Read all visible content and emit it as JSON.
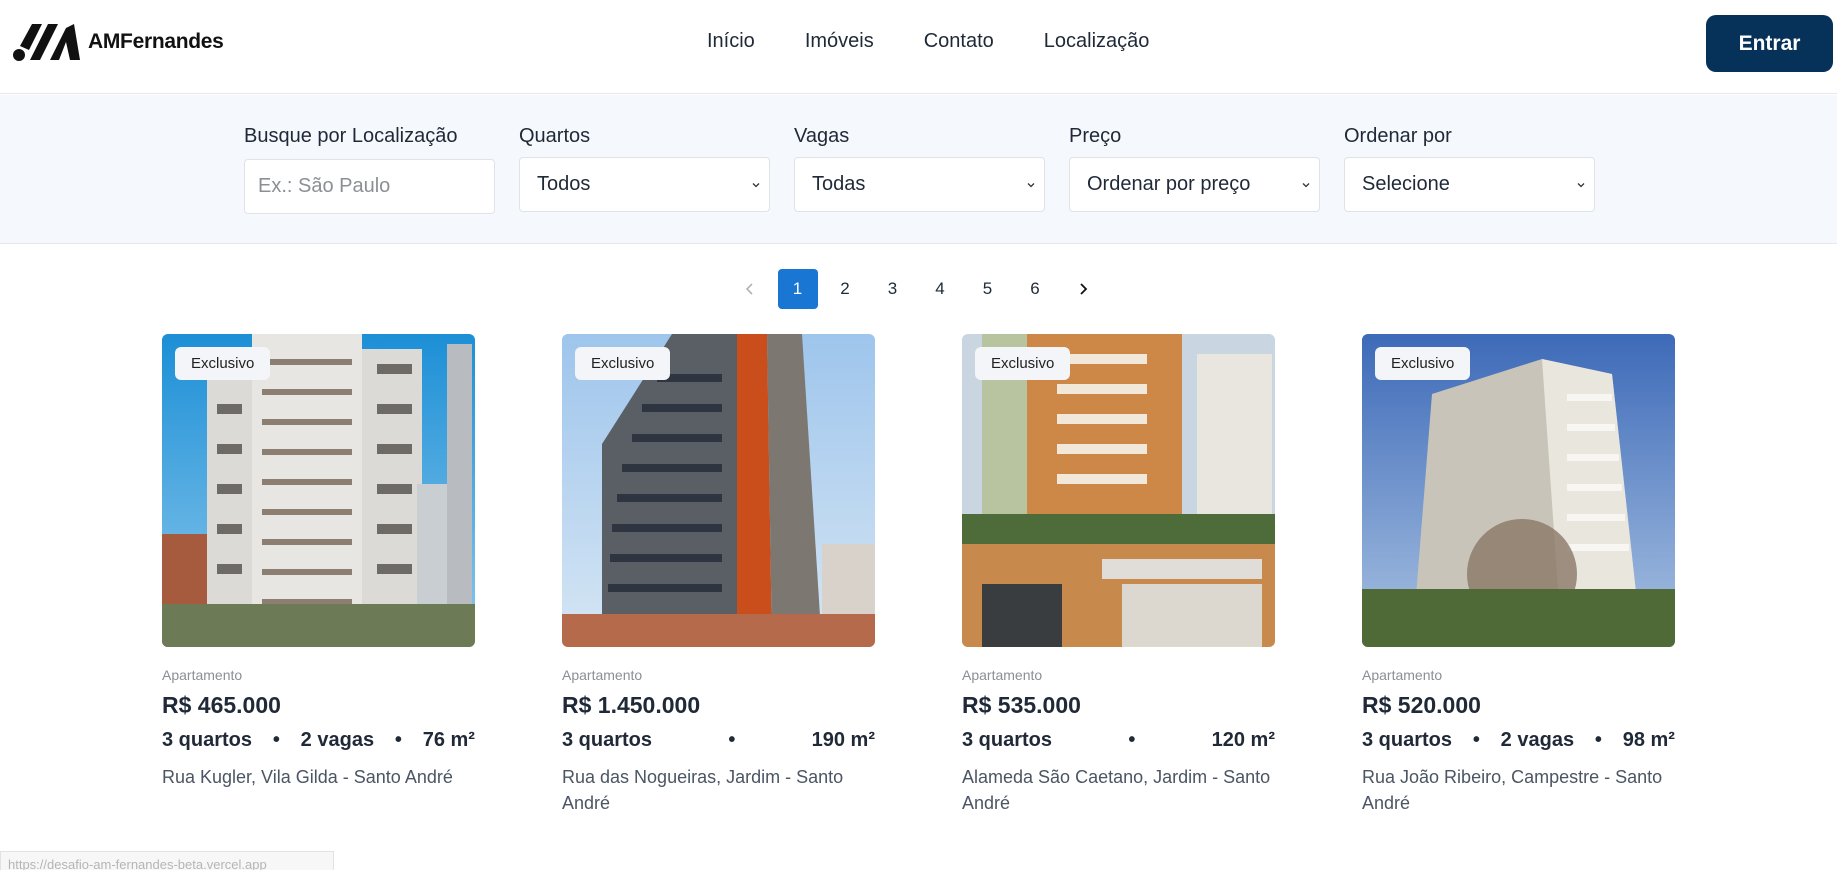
{
  "brand": {
    "name": "AMFernandes"
  },
  "nav": {
    "items": [
      {
        "label": "Início"
      },
      {
        "label": "Imóveis"
      },
      {
        "label": "Contato"
      },
      {
        "label": "Localização"
      }
    ],
    "login_label": "Entrar"
  },
  "filters": {
    "location": {
      "label": "Busque por Localização",
      "placeholder": "Ex.: São Paulo"
    },
    "rooms": {
      "label": "Quartos",
      "selected": "Todos"
    },
    "parking": {
      "label": "Vagas",
      "selected": "Todas"
    },
    "price": {
      "label": "Preço",
      "selected": "Ordenar por preço"
    },
    "sort": {
      "label": "Ordenar por",
      "selected": "Selecione"
    }
  },
  "pagination": {
    "pages": [
      "1",
      "2",
      "3",
      "4",
      "5",
      "6"
    ],
    "current": "1"
  },
  "listings": [
    {
      "badge": "Exclusivo",
      "type": "Apartamento",
      "price": "R$ 465.000",
      "rooms": "3 quartos",
      "parking": "2 vagas",
      "area": "76 m²",
      "address": "Rua Kugler, Vila Gilda - Santo André"
    },
    {
      "badge": "Exclusivo",
      "type": "Apartamento",
      "price": "R$ 1.450.000",
      "rooms": "3 quartos",
      "parking": "",
      "area": "190 m²",
      "address": "Rua das Nogueiras, Jardim - Santo André"
    },
    {
      "badge": "Exclusivo",
      "type": "Apartamento",
      "price": "R$ 535.000",
      "rooms": "3 quartos",
      "parking": "",
      "area": "120 m²",
      "address": "Alameda São Caetano, Jardim - Santo André"
    },
    {
      "badge": "Exclusivo",
      "type": "Apartamento",
      "price": "R$ 520.000",
      "rooms": "3 quartos",
      "parking": "2 vagas",
      "area": "98 m²",
      "address": "Rua João Ribeiro, Campestre - Santo André"
    }
  ],
  "spec_separator": "•",
  "status_bar": {
    "url": "https://desafio-am-fernandes-beta.vercel.app"
  },
  "colors": {
    "primary": "#063159",
    "accent": "#1976d2",
    "filter_bg": "#f5f8fc"
  }
}
